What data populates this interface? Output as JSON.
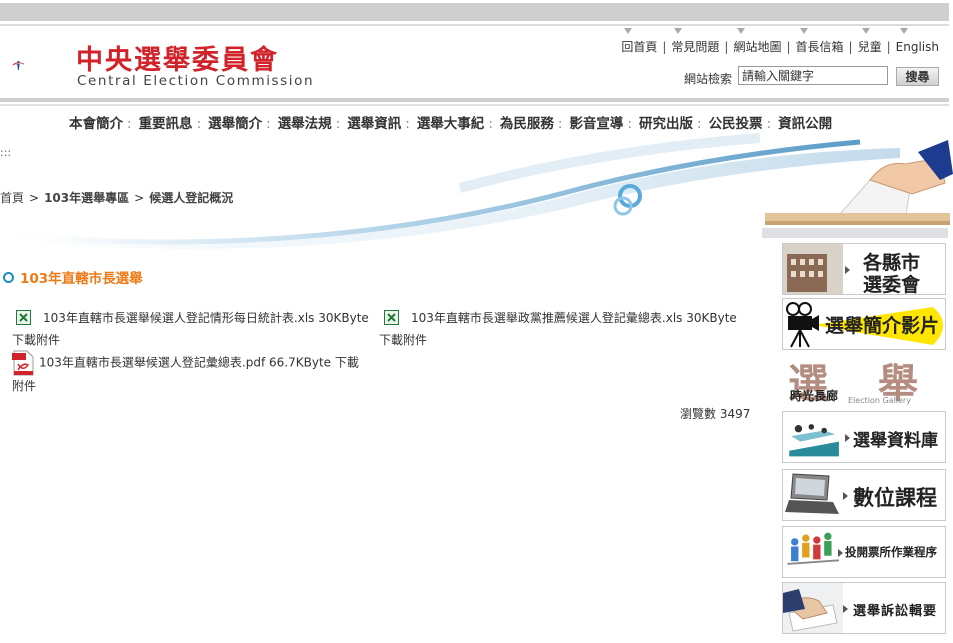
{
  "header": {
    "logo_zh": "中央選舉委員會",
    "logo_en": "Central Election Commission",
    "utility_links": [
      "回首頁",
      "常見問題",
      "網站地圖",
      "首長信箱",
      "兒童",
      "English"
    ],
    "search_label": "網站檢索",
    "search_value": "請輸入關鍵字",
    "search_button": "搜尋"
  },
  "nav": {
    "items": [
      "本會簡介",
      "重要訊息",
      "選舉簡介",
      "選舉法規",
      "選舉資訊",
      "選舉大事紀",
      "為民服務",
      "影音宣導",
      "研究出版",
      "公民投票",
      "資訊公開"
    ]
  },
  "accesskey": ":::",
  "breadcrumb": {
    "home": "首頁",
    "level1": "103年選舉專區",
    "current": "候選人登記概況",
    "separator": ">"
  },
  "section_title": "103年直轄市長選舉",
  "files": [
    {
      "type": "xls",
      "name": "103年直轄市長選舉候選人登記情形每日統計表.xls",
      "size": "30KByte",
      "download": "下載附件"
    },
    {
      "type": "xls",
      "name": "103年直轄市長選舉政黨推薦候選人登記彙總表.xls",
      "size": "30KByte",
      "download": "下載附件"
    },
    {
      "type": "pdf",
      "name": "103年直轄市長選舉候選人登記彙總表.pdf",
      "size": "66.7KByte",
      "download": "下載",
      "download2": "附件"
    }
  ],
  "views_label": "瀏覽數 3497",
  "sidebar": {
    "items": [
      {
        "label_line1": "各縣市",
        "label_line2": "選委會"
      },
      {
        "label": "選舉簡介影片"
      },
      {
        "label": "選舉",
        "sub": "時光長廊",
        "sub_en": "Election Gallery"
      },
      {
        "label": "選舉資料庫"
      },
      {
        "label": "數位課程"
      },
      {
        "label": "投開票所作業程序"
      },
      {
        "label": "選舉訴訟輯要"
      }
    ]
  },
  "colors": {
    "brand_red": "#d2232a",
    "section_orange": "#ee7a16",
    "accent_blue": "#1a8fc0",
    "video_yellow": "#ffe600"
  }
}
